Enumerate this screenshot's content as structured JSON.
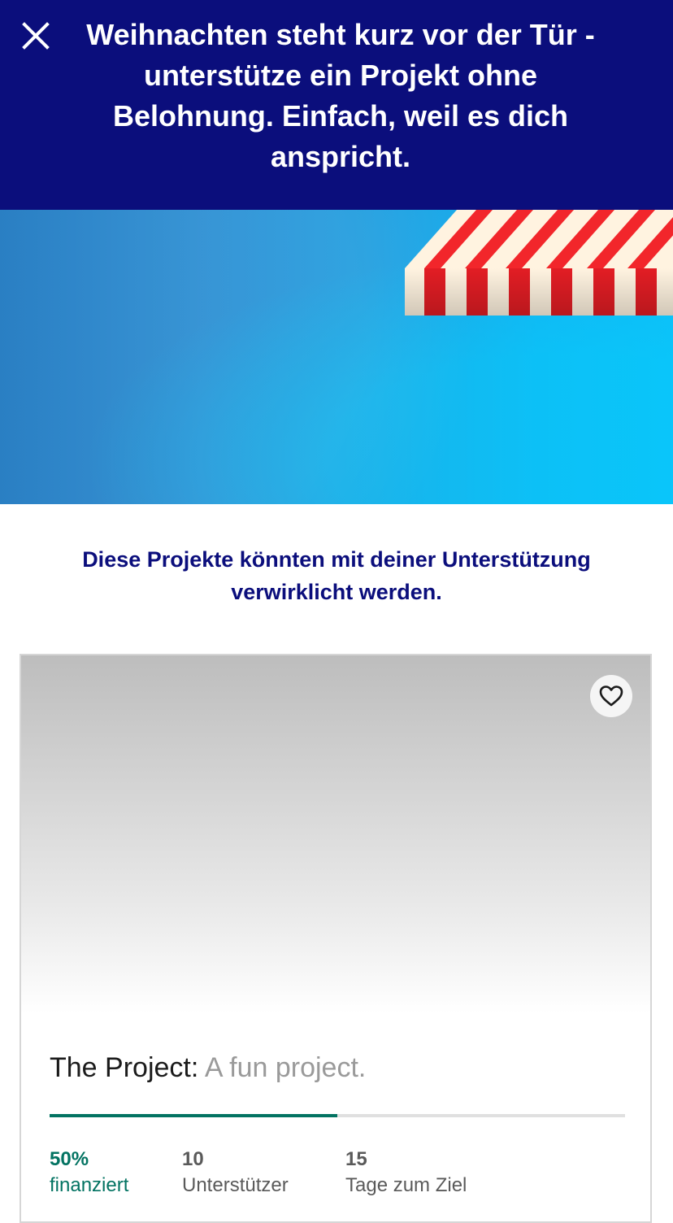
{
  "banner": {
    "close_icon": "close-icon",
    "message": "Weihnachten steht kurz vor der Tür - unterstütze ein Projekt ohne Belohnung. Einfach, weil es dich anspricht.",
    "background": "#0b0e7c"
  },
  "intro": {
    "text": "Diese Projekte könnten mit deiner Unterstützung verwirklicht werden."
  },
  "project_card": {
    "favorite_icon": "heart-outline-icon",
    "title": "The Project:",
    "blurb": "A fun project.",
    "progress_fraction": 0.5,
    "stats": {
      "funded_value": "50%",
      "funded_label": "finanziert",
      "backers_value": "10",
      "backers_label": "Unterstützer",
      "days_value": "15",
      "days_label": "Tage zum Ziel"
    }
  },
  "colors": {
    "brand_navy": "#0b0e7c",
    "success_green": "#037362"
  }
}
